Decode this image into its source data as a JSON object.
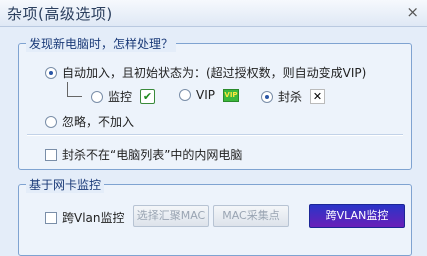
{
  "window": {
    "title": "杂项(高级选项)",
    "close_glyph": "×"
  },
  "new_pc_group": {
    "legend": "发现新电脑时，怎样处理？",
    "auto_add_label": "自动加入，且初始状态为：(超过授权数，则自动变成VIP)",
    "auto_add_selected": true,
    "status_options": [
      {
        "label": "监控",
        "icon": "check-mark-icon",
        "glyph": "✔",
        "selected": false
      },
      {
        "label": "VIP",
        "icon": "vip-badge-icon",
        "glyph": "VIP",
        "selected": false
      },
      {
        "label": "封杀",
        "icon": "x-mark-icon",
        "glyph": "✕",
        "selected": true
      }
    ],
    "ignore_label": "忽略，不加入",
    "ignore_selected": false,
    "block_exclude_label": "封杀不在“电脑列表”中的内网电脑",
    "block_exclude_checked": false
  },
  "nic_group": {
    "legend": "基于网卡监控",
    "cross_vlan_label": "跨Vlan监控",
    "cross_vlan_checked": false,
    "select_aggregate_mac_btn": "选择汇聚MAC",
    "mac_collect_btn": "MAC采集点",
    "cross_vlan_monitor_btn": "跨VLAN监控"
  }
}
